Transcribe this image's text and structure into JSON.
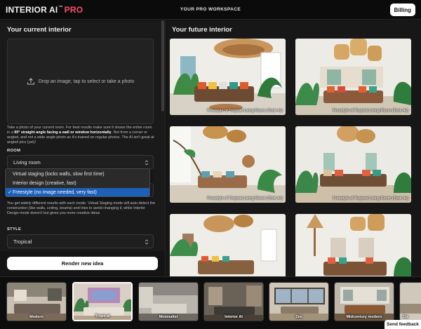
{
  "header": {
    "logo_main": "INTERIOR AI",
    "logo_tm": "™",
    "logo_pro": "PRO",
    "workspace": "YOUR PRO WORKSPACE",
    "billing": "Billing"
  },
  "left": {
    "title": "Your current interior",
    "dropzone_text": "Drop an image, tap to select or take a photo",
    "help_pre": "Take a photo of your current room. For best results make sure it shows the entire room in a ",
    "help_bold": "90° straight angle facing a wall or window horizontally",
    "help_post": ". Not from a corner or angled, and not a wide angle photo as it's trained on regular photos. The AI isn't great at angled pics (yet)!",
    "room_label": "ROOM",
    "room_value": "Living room",
    "mode_options": [
      "Virtual staging (locks walls, slow first time)",
      "Interior design (creative, fast)",
      "Freestyle (no image needed, very fast)"
    ],
    "mode_selected_index": 2,
    "mode_check": "✓",
    "modes_note": "You get widely different results with each mode. Virtual Staging mode will auto detect the construction (like walls, ceiling, beams) and tries to avoid changing it, while Interior Design mode doesn't but gives you more creative ideas",
    "style_label": "STYLE",
    "style_value": "Tropical",
    "render_button": "Render new idea"
  },
  "right": {
    "title": "Your future interior",
    "results": [
      {
        "caption": "Freestyle of Tropical Living Room (Took 4s)"
      },
      {
        "caption": "Freestyle of Tropical Living Room (Took 4s)"
      },
      {
        "caption": "Freestyle of Tropical Living Room (Took 4s)"
      },
      {
        "caption": "Freestyle of Tropical Living Room (Took 4s)"
      },
      {
        "caption": ""
      },
      {
        "caption": ""
      }
    ]
  },
  "styles": [
    {
      "label": "Modern"
    },
    {
      "label": "Tropical",
      "active": true
    },
    {
      "label": "Minimalist"
    },
    {
      "label": "Interior AI"
    },
    {
      "label": "Zen"
    },
    {
      "label": "Midcentury modern"
    },
    {
      "label": "Co"
    }
  ],
  "feedback": "Send feedback",
  "colors": {
    "accent_pro": "#ff4d6d",
    "selected_option": "#1e5fb8",
    "background": "#111111",
    "panel": "#1a1a1a"
  },
  "icons": [
    "upload-icon",
    "chevron-updown-icon",
    "checkmark-icon"
  ]
}
